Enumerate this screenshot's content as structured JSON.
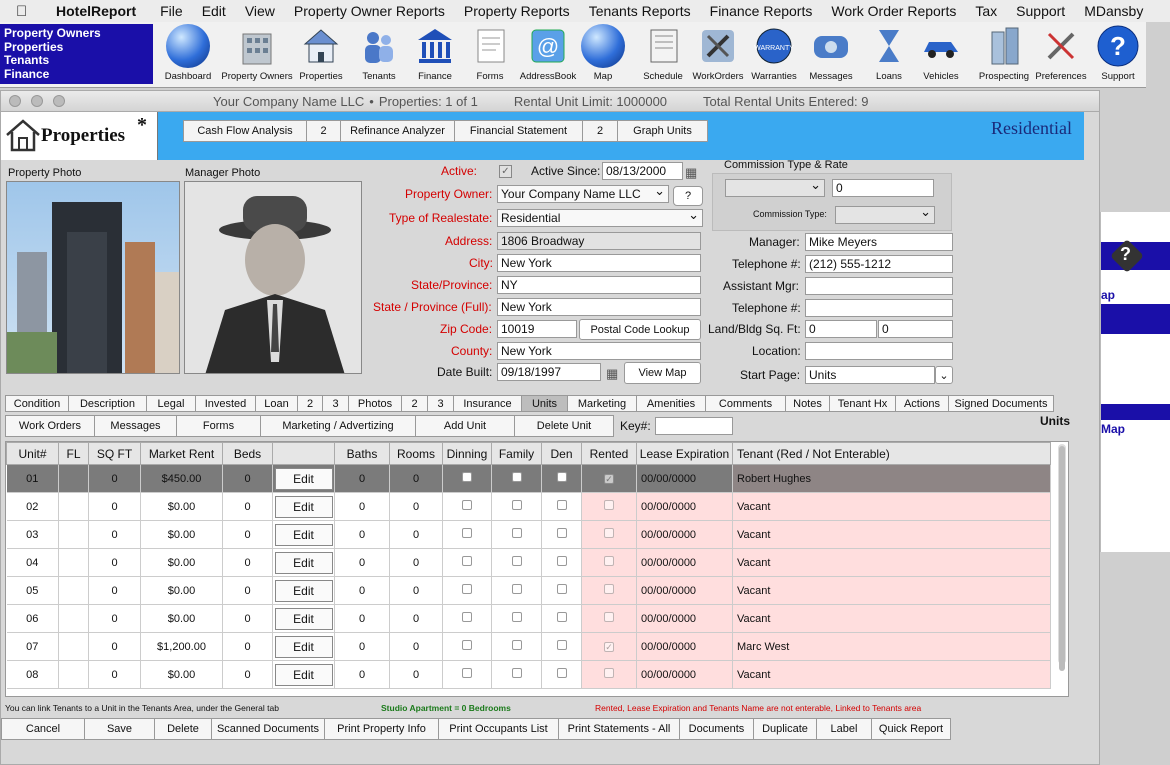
{
  "menubar": {
    "app": "HotelReport",
    "items": [
      "File",
      "Edit",
      "View",
      "Property Owner Reports",
      "Property Reports",
      "Tenants Reports",
      "Finance Reports",
      "Work Order Reports",
      "Tax",
      "Support",
      "MDansby"
    ]
  },
  "nav_left": [
    "Property Owners",
    "Properties",
    "Tenants",
    "Finance"
  ],
  "toolbar": [
    "Dashboard",
    "Property Owners",
    "Properties",
    "Tenants",
    "Finance",
    "Forms",
    "AddressBook",
    "Map",
    "Schedule",
    "WorkOrders",
    "Warranties",
    "Messages",
    "Loans",
    "Vehicles",
    "Prospecting",
    "Preferences",
    "Support"
  ],
  "titlebar": {
    "company": "Your Company Name LLC",
    "properties": "Properties: 1 of 1",
    "limit": "Rental Unit Limit: 1000000",
    "entered": "Total Rental Units Entered: 9",
    "separator": "•"
  },
  "header": {
    "title": "Properties",
    "star": "*",
    "buttons": [
      "Cash Flow Analysis",
      "2",
      "Refinance Analyzer",
      "Financial Statement",
      "2",
      "Graph Units"
    ],
    "type_label": "Residential"
  },
  "photos": {
    "property": "Property Photo",
    "manager": "Manager Photo"
  },
  "form": {
    "active_label": "Active:",
    "active_since_label": "Active Since:",
    "active_since": "08/13/2000",
    "owner_label": "Property Owner:",
    "owner": "Your Company Name LLC",
    "owner_help": "?",
    "type_label": "Type of Realestate:",
    "type": "Residential",
    "address_label": "Address:",
    "address": "1806 Broadway",
    "city_label": "City:",
    "city": "New York",
    "state_label": "State/Province:",
    "state": "NY",
    "state_full_label": "State / Province (Full):",
    "state_full": "New York",
    "zip_label": "Zip Code:",
    "zip": "10019",
    "postal_lookup": "Postal Code Lookup",
    "county_label": "County:",
    "county": "New York",
    "built_label": "Date Built:",
    "built": "09/18/1997",
    "view_map": "View Map",
    "commission_header": "Commission Type & Rate",
    "commission_rate": "0",
    "commission_type_label": "Commission Type:",
    "manager_label": "Manager:",
    "manager": "Mike Meyers",
    "tel_label": "Telephone #:",
    "tel": "(212) 555-1212",
    "asst_label": "Assistant Mgr:",
    "asst": "",
    "tel2_label": "Telephone #:",
    "tel2": "",
    "sqft_label": "Land/Bldg Sq. Ft:",
    "land": "0",
    "bldg": "0",
    "location_label": "Location:",
    "location": "",
    "start_label": "Start Page:",
    "start": "Units"
  },
  "tabs": [
    "Condition",
    "Description",
    "Legal",
    "Invested",
    "Loan",
    "2",
    "3",
    "Photos",
    "2",
    "3",
    "Insurance",
    "Units",
    "Marketing",
    "Amenities",
    "Comments",
    "Notes",
    "Tenant Hx",
    "Actions",
    "Signed Documents"
  ],
  "active_tab": "Units",
  "subbar": {
    "buttons": [
      "Work Orders",
      "Messages",
      "Forms",
      "Marketing / Advertizing",
      "Add Unit",
      "Delete Unit"
    ],
    "key_label": "Key#:",
    "units_label": "Units"
  },
  "grid": {
    "headers": [
      "Unit#",
      "FL",
      "SQ FT",
      "Market Rent",
      "Beds",
      "",
      "Baths",
      "Rooms",
      "Dinning",
      "Family",
      "Den",
      "Rented",
      "Lease Expiration",
      "Tenant (Red / Not Enterable)"
    ],
    "edit_label": "Edit",
    "rows": [
      {
        "unit": "01",
        "fl": "",
        "sqft": "0",
        "rent": "$450.00",
        "beds": "0",
        "baths": "0",
        "rooms": "0",
        "rented": true,
        "lease": "00/00/0000",
        "tenant": "Robert Hughes"
      },
      {
        "unit": "02",
        "fl": "",
        "sqft": "0",
        "rent": "$0.00",
        "beds": "0",
        "baths": "0",
        "rooms": "0",
        "rented": false,
        "lease": "00/00/0000",
        "tenant": "Vacant"
      },
      {
        "unit": "03",
        "fl": "",
        "sqft": "0",
        "rent": "$0.00",
        "beds": "0",
        "baths": "0",
        "rooms": "0",
        "rented": false,
        "lease": "00/00/0000",
        "tenant": "Vacant"
      },
      {
        "unit": "04",
        "fl": "",
        "sqft": "0",
        "rent": "$0.00",
        "beds": "0",
        "baths": "0",
        "rooms": "0",
        "rented": false,
        "lease": "00/00/0000",
        "tenant": "Vacant"
      },
      {
        "unit": "05",
        "fl": "",
        "sqft": "0",
        "rent": "$0.00",
        "beds": "0",
        "baths": "0",
        "rooms": "0",
        "rented": false,
        "lease": "00/00/0000",
        "tenant": "Vacant"
      },
      {
        "unit": "06",
        "fl": "",
        "sqft": "0",
        "rent": "$0.00",
        "beds": "0",
        "baths": "0",
        "rooms": "0",
        "rented": false,
        "lease": "00/00/0000",
        "tenant": "Vacant"
      },
      {
        "unit": "07",
        "fl": "",
        "sqft": "0",
        "rent": "$1,200.00",
        "beds": "0",
        "baths": "0",
        "rooms": "0",
        "rented": true,
        "lease": "00/00/0000",
        "tenant": "Marc West"
      },
      {
        "unit": "08",
        "fl": "",
        "sqft": "0",
        "rent": "$0.00",
        "beds": "0",
        "baths": "0",
        "rooms": "0",
        "rented": false,
        "lease": "00/00/0000",
        "tenant": "Vacant"
      }
    ]
  },
  "footnotes": {
    "left": "You can link Tenants to a Unit in the Tenants Area, under the General tab",
    "mid": "Studio Apartment = 0 Bedrooms",
    "right": "Rented, Lease Expiration and Tenants Name are not enterable, Linked to Tenants area"
  },
  "bottombar": [
    "Cancel",
    "Save",
    "Delete",
    "Scanned Documents",
    "Print Property Info",
    "Print Occupants List",
    "Print Statements - All",
    "Documents",
    "Duplicate",
    "Label",
    "Quick Report"
  ],
  "right_panel": {
    "map1": "ap",
    "map2": "Map",
    "help": "?"
  },
  "colors": {
    "nav_blue": "#1a0fa8",
    "header_blue": "#3aa9f0",
    "required_red": "#d40000",
    "tenant_pink": "#ffdede",
    "foot_green": "#1a7a1a"
  }
}
